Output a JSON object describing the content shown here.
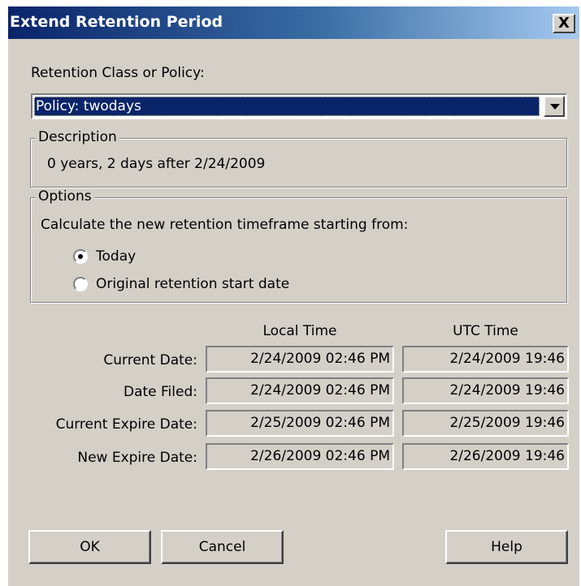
{
  "window": {
    "title": "Extend Retention Period",
    "close_symbol": "X"
  },
  "retention": {
    "label": "Retention Class or Policy:",
    "selected": "Policy: twodays"
  },
  "description": {
    "title": "Description",
    "text": "0 years, 2 days after 2/24/2009"
  },
  "options": {
    "title": "Options",
    "prompt": "Calculate the new retention timeframe starting from:",
    "radios": [
      {
        "label": "Today",
        "checked": true
      },
      {
        "label": "Original retention start date",
        "checked": false
      }
    ]
  },
  "dates": {
    "columns": [
      "Local Time",
      "UTC Time"
    ],
    "rows": [
      {
        "label": "Current Date:",
        "local": "2/24/2009 02:46 PM",
        "utc": "2/24/2009 19:46"
      },
      {
        "label": "Date Filed:",
        "local": "2/24/2009 02:46 PM",
        "utc": "2/24/2009 19:46"
      },
      {
        "label": "Current Expire Date:",
        "local": "2/25/2009 02:46 PM",
        "utc": "2/25/2009 19:46"
      },
      {
        "label": "New Expire Date:",
        "local": "2/26/2009 02:46 PM",
        "utc": "2/26/2009 19:46"
      }
    ]
  },
  "buttons": {
    "ok": "OK",
    "cancel": "Cancel",
    "help": "Help"
  }
}
